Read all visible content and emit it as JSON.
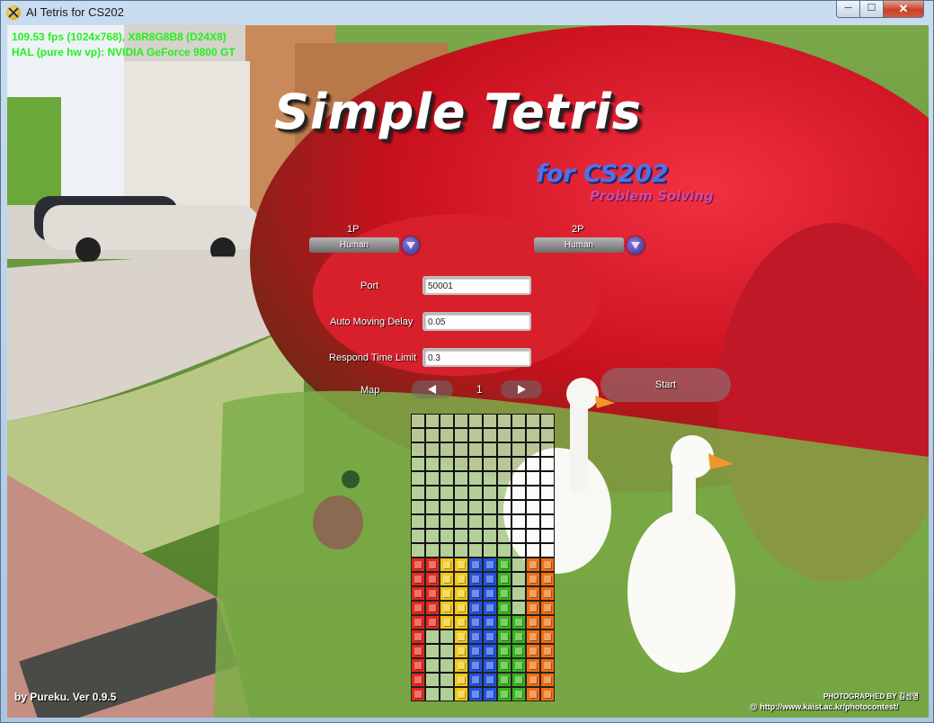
{
  "window": {
    "title": "AI Tetris for CS202",
    "min_glyph": "─",
    "max_glyph": "☐",
    "close_glyph": "✕"
  },
  "hud": {
    "line1": "109.53 fps (1024x768), X8R8G8B8 (D24X8)",
    "line2": "HAL (pure hw vp): NVIDIA GeForce 9800 GT"
  },
  "logo": {
    "title": "Simple Tetris",
    "subtitle": "for CS202",
    "tagline": "Problem Solving"
  },
  "players": {
    "p1": {
      "label": "1P",
      "value": "Human"
    },
    "p2": {
      "label": "2P",
      "value": "Human"
    }
  },
  "settings": {
    "port_label": "Port",
    "port_value": "50001",
    "delay_label": "Auto Moving Delay",
    "delay_value": "0.05",
    "limit_label": "Respond Time Limit",
    "limit_value": "0.3",
    "map_label": "Map",
    "map_value": "1"
  },
  "start_label": "Start",
  "footer": {
    "version": "by Pureku. Ver 0.9.5",
    "photo_credit": "PHOTOGRAPHED BY 김선영",
    "photo_url": "@ http://www.kaist.ac.kr/photocontest/"
  },
  "colors": {
    "red": "#e12a1c",
    "yellow": "#f2c814",
    "blue": "#2452e0",
    "green": "#3cb41e",
    "orange": "#f06e10",
    "hud": "#22f01e"
  },
  "board": {
    "columns": 10,
    "rows": 20,
    "grid": [
      "..........",
      "..........",
      "..........",
      "..........",
      "..........",
      "..........",
      "..........",
      "..........",
      "..........",
      "..........",
      "RRYYBBG.OO",
      "RRYYBBG.OO",
      "RRYYBBG.OO",
      "RRYYBBG.OO",
      "RRYYBBGGOO",
      "R..YBBGGOO",
      "R..YBBGGOO",
      "R..YBBGGOO",
      "R..YBBGGOO",
      "R..YBBGGOO"
    ]
  }
}
